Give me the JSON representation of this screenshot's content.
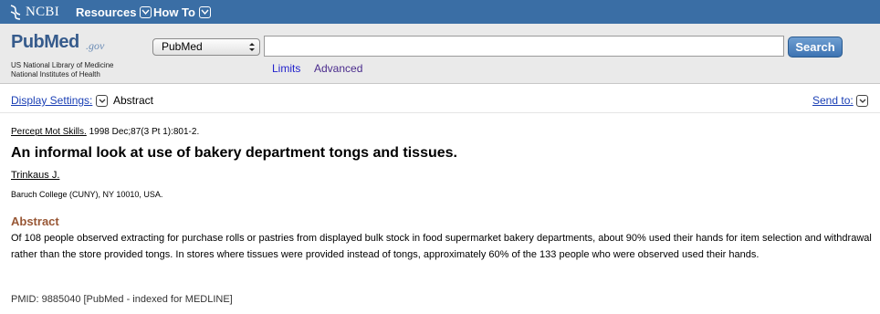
{
  "ncbi_bar": {
    "logo_text": "NCBI",
    "menu": [
      {
        "label": "Resources"
      },
      {
        "label": "How To"
      }
    ]
  },
  "search_area": {
    "logo_main": "PubMed",
    "logo_suffix": ".gov",
    "org_line_1": "US National Library of Medicine",
    "org_line_2": "National Institutes of Health",
    "database": "PubMed",
    "query": "",
    "search_button": "Search",
    "limits_link": "Limits",
    "advanced_link": "Advanced"
  },
  "display_bar": {
    "display_settings": "Display Settings:",
    "format": "Abstract",
    "send_to": "Send to:"
  },
  "article": {
    "journal": "Percept Mot Skills.",
    "citation_rest": " 1998 Dec;87(3 Pt 1):801-2.",
    "title": "An informal look at use of bakery department tongs and tissues.",
    "author": "Trinkaus J.",
    "affiliation": "Baruch College (CUNY), NY 10010, USA.",
    "abstract_heading": "Abstract",
    "abstract_text": "Of 108 people observed extracting for purchase rolls or pastries from displayed bulk stock in food supermarket bakery departments, about 90% used their hands for item selection and withdrawal rather than the store provided tongs. In stores where tissues were provided instead of tongs, approximately 60% of the 133 people who were observed used their hands.",
    "pmid": "PMID: 9885040 [PubMed - indexed for MEDLINE]"
  },
  "colors": {
    "ncbi_bar": "#3a6ea5",
    "search_area": "#eaeaea",
    "link": "#1a3fb5",
    "abstract_heading": "#985735"
  },
  "icons": [
    "ncbi-helix-icon",
    "chevron-down-icon",
    "select-arrows-icon"
  ]
}
